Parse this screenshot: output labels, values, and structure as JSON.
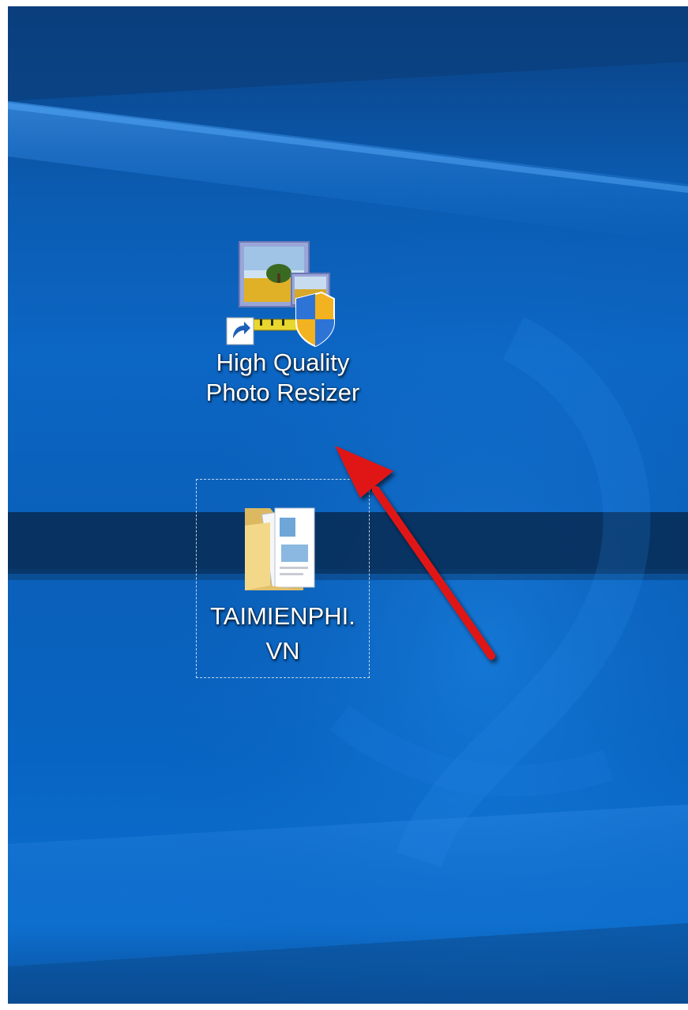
{
  "desktop": {
    "icons": [
      {
        "label_line1": "High Quality",
        "label_line2": "Photo Resizer",
        "icon": "photo-resizer-shortcut-icon",
        "is_shortcut": true
      },
      {
        "label_line1": "TAIMIENPHI.",
        "label_line2": "VN",
        "icon": "folder-icon",
        "selected_focus": true
      }
    ],
    "annotation": {
      "type": "arrow",
      "color": "#e01818",
      "points_to": "High Quality Photo Resizer"
    },
    "wallpaper": {
      "name": "windows-10-hero-wallpaper",
      "base_color": "#0c66c4"
    }
  }
}
